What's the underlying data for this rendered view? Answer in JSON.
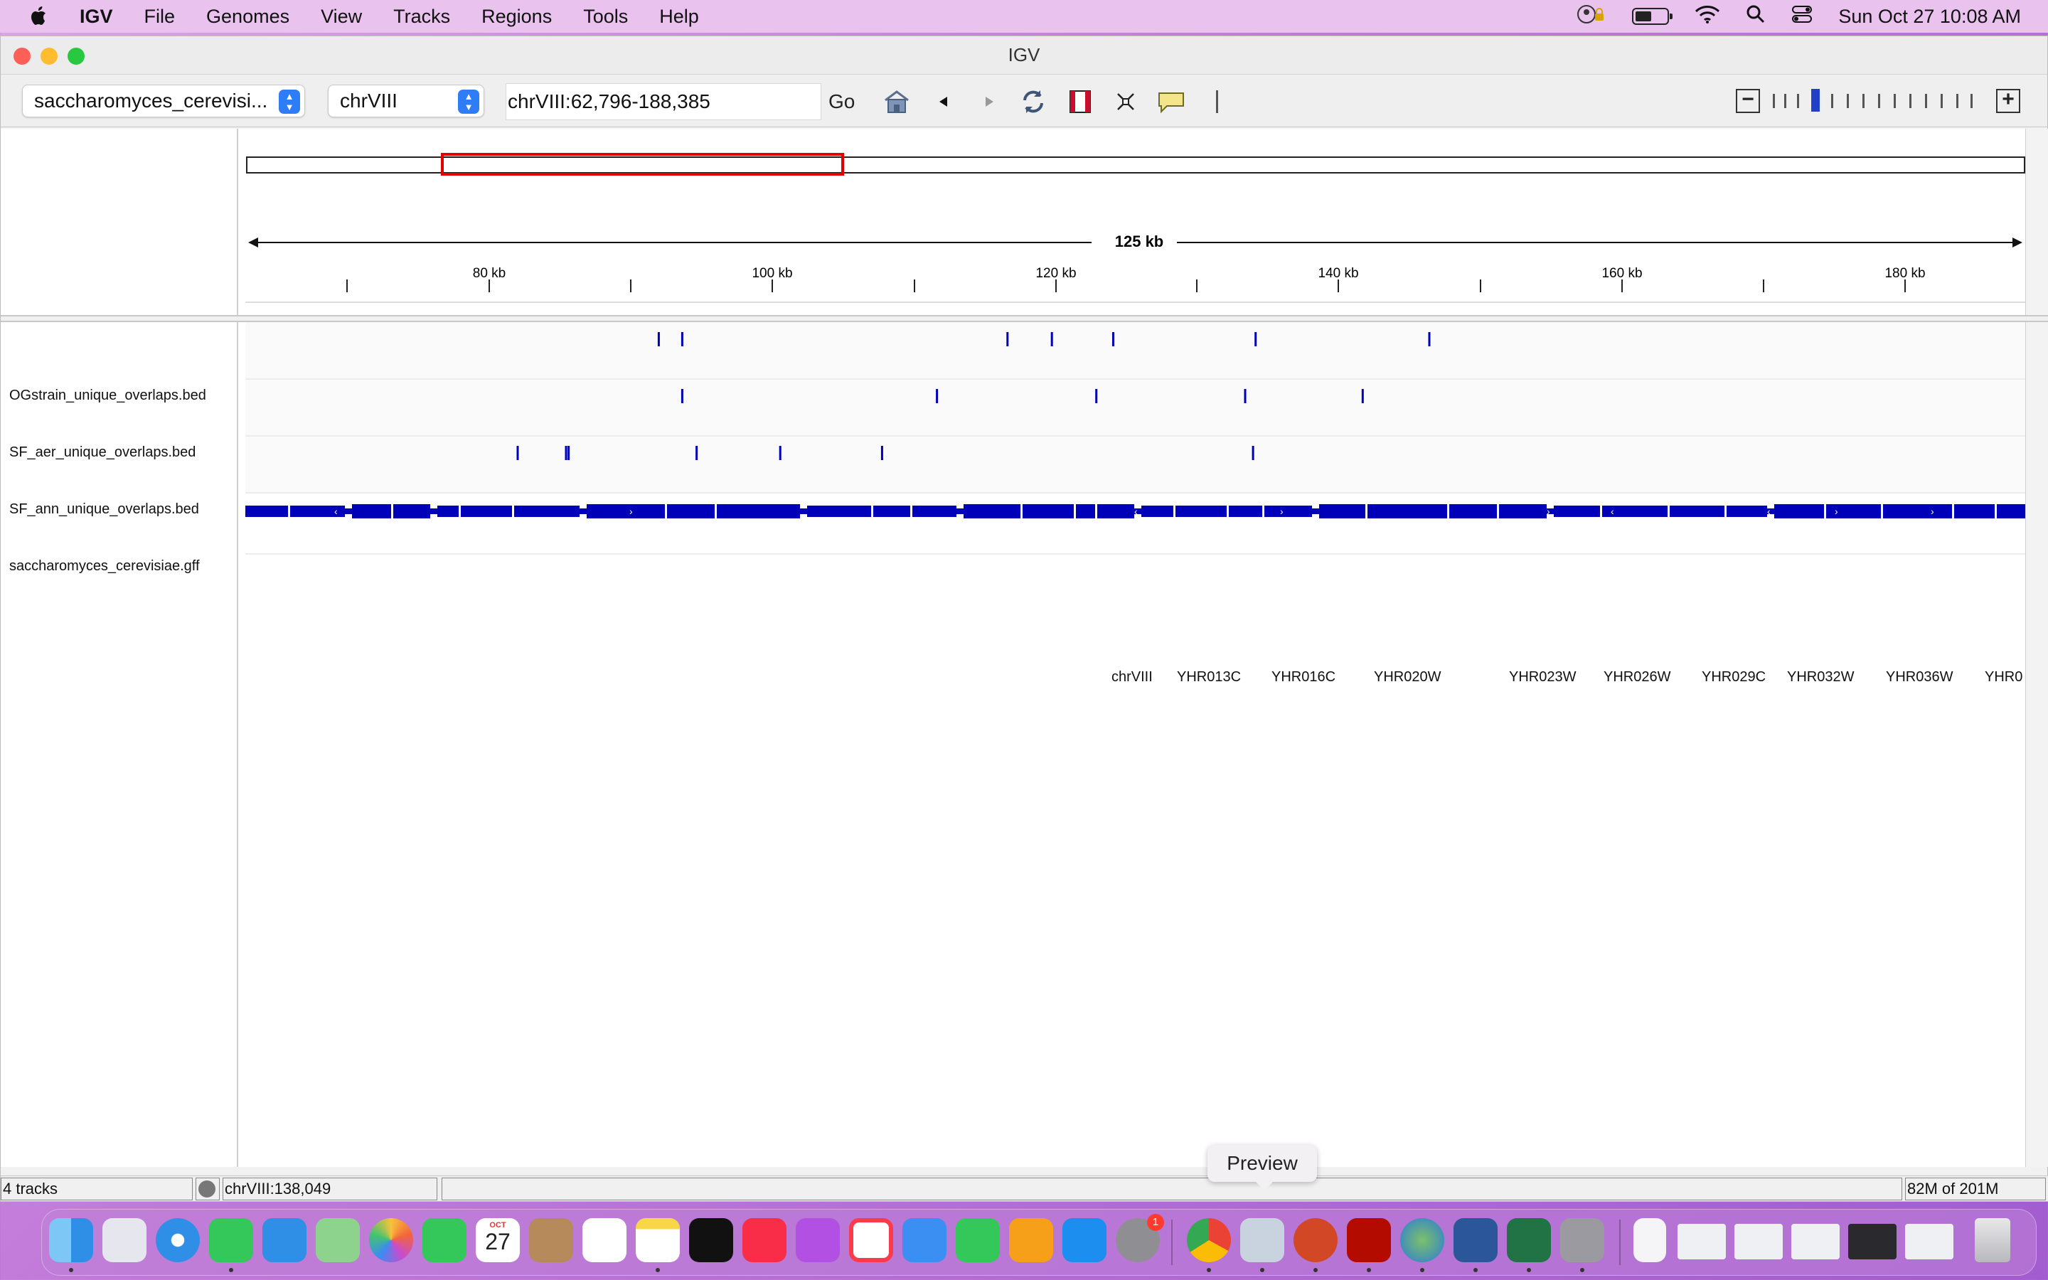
{
  "menubar": {
    "app_name": "IGV",
    "menus": [
      "File",
      "Genomes",
      "View",
      "Tracks",
      "Regions",
      "Tools",
      "Help"
    ],
    "clock": "Sun Oct 27  10:08 AM"
  },
  "window": {
    "title": "IGV"
  },
  "toolbar": {
    "genome": "saccharomyces_cerevisi...",
    "chromosome": "chrVIII",
    "locus": "chrVIII:62,796-188,385",
    "go_label": "Go"
  },
  "ruler": {
    "span_label": "125 kb",
    "ticks": [
      "80 kb",
      "100 kb",
      "120 kb",
      "140 kb",
      "160 kb",
      "180 kb"
    ]
  },
  "tracks": [
    {
      "name": "OGstrain_unique_overlaps.bed",
      "features": [
        503,
        521,
        770,
        804,
        851,
        960,
        1093
      ]
    },
    {
      "name": "SF_aer_unique_overlaps.bed",
      "features": [
        521,
        716,
        838,
        952,
        1042
      ]
    },
    {
      "name": "SF_ann_unique_overlaps.bed",
      "features": [
        395,
        432,
        434,
        532,
        596,
        674,
        958
      ]
    },
    {
      "name": "saccharomyces_cerevisiae.gff"
    }
  ],
  "gene_labels": [
    "chrVIII",
    "YHR013C",
    "YHR016C",
    "YHR020W",
    "YHR023W",
    "YHR026W",
    "YHR029C",
    "YHR032W",
    "YHR036W",
    "YHR0"
  ],
  "status": {
    "track_count": "4 tracks",
    "position": "chrVIII:138,049",
    "memory": "82M of 201M"
  },
  "tooltip": "Preview",
  "dock": {
    "calendar_month": "OCT",
    "calendar_day": "27",
    "badge": "1"
  },
  "colors": {
    "feature_blue": "#0000b8",
    "region_red": "#e00000"
  }
}
